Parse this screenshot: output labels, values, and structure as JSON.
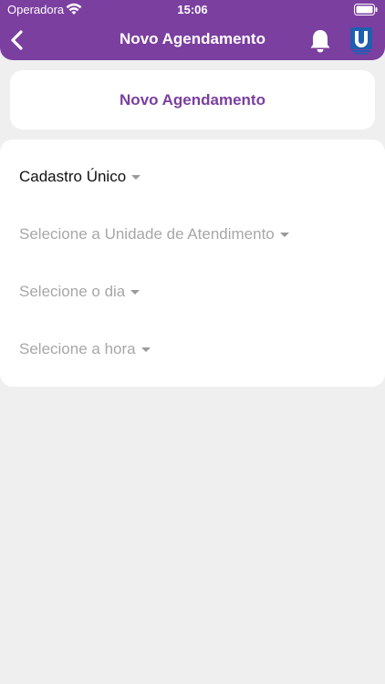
{
  "status_bar": {
    "carrier": "Operadora",
    "time": "15:06",
    "wifi_icon": "wifi-icon",
    "battery_icon": "battery-icon"
  },
  "nav": {
    "title": "Novo Agendamento",
    "back_icon": "chevron-left-icon",
    "bell_icon": "bell-icon",
    "logo_icon": "app-logo-icon"
  },
  "header_card": {
    "title": "Novo Agendamento"
  },
  "form": {
    "service": {
      "value": "Cadastro Único"
    },
    "unit": {
      "placeholder": "Selecione a Unidade de Atendimento"
    },
    "day": {
      "placeholder": "Selecione o dia"
    },
    "hour": {
      "placeholder": "Selecione a hora"
    }
  },
  "colors": {
    "brand": "#7b3fa0",
    "background": "#efefef",
    "placeholder": "#a7a7a7",
    "logo_blue": "#1f5fb0"
  }
}
